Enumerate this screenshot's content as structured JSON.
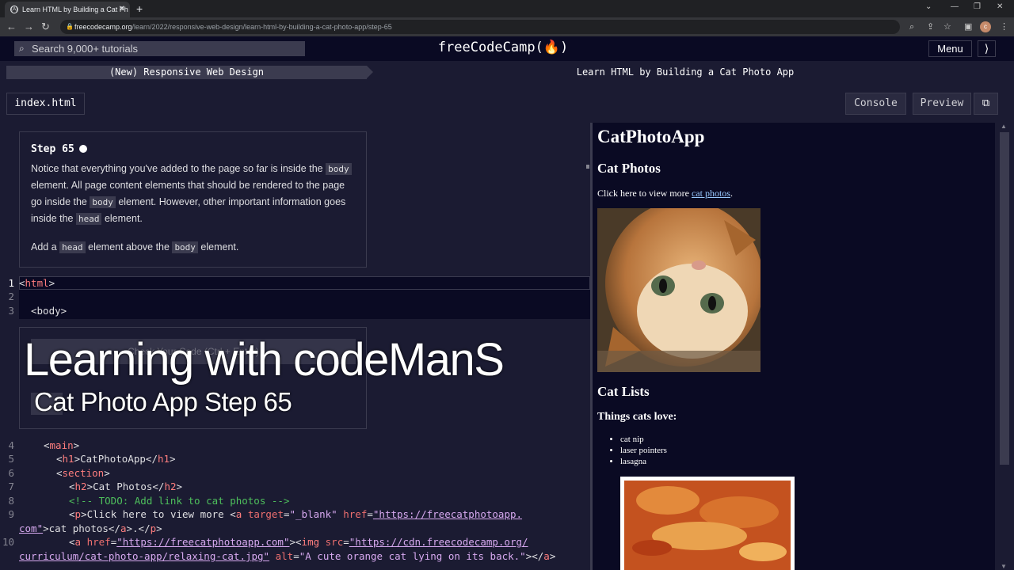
{
  "browser": {
    "tab_title": "Learn HTML by Building a Cat Ph",
    "tab_favicon": "(A)",
    "url_host": "freecodecamp.org",
    "url_path": "/learn/2022/responsive-web-design/learn-html-by-building-a-cat-photo-app/step-65",
    "profile_initial": "c"
  },
  "nav": {
    "search_placeholder": "Search 9,000+ tutorials",
    "logo": "freeCodeCamp(🔥)",
    "menu_label": "Menu"
  },
  "breadcrumb": {
    "course": "(New) Responsive Web Design",
    "project": "Learn HTML by Building a Cat Photo App"
  },
  "toolbar": {
    "file_tab": "index.html",
    "console_label": "Console",
    "preview_label": "Preview"
  },
  "instructions": {
    "step_title": "Step 65",
    "p1_a": "Notice that everything you've added to the page so far is inside the ",
    "p1_code1": "body",
    "p1_b": " element. All page content elements that should be rendered to the page go inside the ",
    "p1_code2": "body",
    "p1_c": " element. However, other important information goes inside the ",
    "p1_code3": "head",
    "p1_d": " element.",
    "p2_a": "Add a ",
    "p2_code1": "head",
    "p2_b": " element above the ",
    "p2_code2": "body",
    "p2_c": " element."
  },
  "check": {
    "button_label": "Check Your Code (Ctrl + Enter)"
  },
  "overlay": {
    "title": "Learning with codeManS",
    "subtitle": "Cat Photo App Step 65"
  },
  "code": {
    "line_numbers": [
      "1",
      "2",
      "3",
      "4",
      "5",
      "6",
      "7",
      "8",
      "9",
      "10"
    ],
    "l1_tag": "html",
    "l3_tag": "body",
    "l4_tag": "main",
    "l5_tag": "h1",
    "l5_text": "CatPhotoApp",
    "l6_tag": "section",
    "l7_tag": "h2",
    "l7_text": "Cat Photos",
    "l8_comment": "<!-- TODO: Add link to cat photos -->",
    "l9_text1": "Click here to view more ",
    "l9_attr_target": "target",
    "l9_val_target": "\"_blank\"",
    "l9_attr_href": "href",
    "l9_val_href": "\"https://freecatphotoapp.",
    "l9_cont_href": "com\"",
    "l9_link_text": "cat photos",
    "l10_attr_href": "href",
    "l10_val_href": "\"https://freecatphotoapp.com\"",
    "l10_attr_src": "src",
    "l10_val_src": "\"https://cdn.freecodecamp.org/",
    "l10_cont_src": "curriculum/cat-photo-app/relaxing-cat.jpg\"",
    "l10_attr_alt": "alt",
    "l10_val_alt": "\"A cute orange cat lying on its back.\""
  },
  "preview": {
    "h1": "CatPhotoApp",
    "h2_photos": "Cat Photos",
    "p_before": "Click here to view more ",
    "p_link": "cat photos",
    "p_after": ".",
    "h2_lists": "Cat Lists",
    "h3_things": "Things cats love:",
    "list": [
      "cat nip",
      "laser pointers",
      "lasagna"
    ]
  }
}
